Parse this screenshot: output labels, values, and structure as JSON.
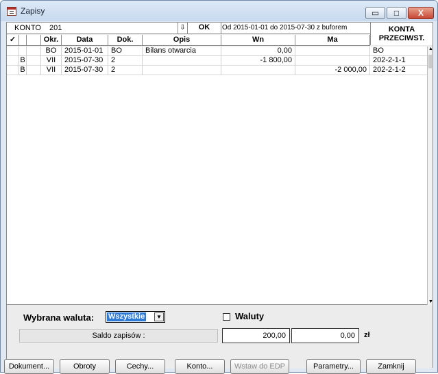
{
  "window": {
    "title": "Zapisy",
    "minimize": "▭",
    "maximize": "□",
    "close": "X"
  },
  "account": {
    "label": "KONTO",
    "number": "201",
    "ok": "OK",
    "period_text": "Od  2015-01-01   do   2015-07-30    z buforem",
    "counter_header": "KONTA PRZECIWST."
  },
  "table": {
    "headers": {
      "check": "✓",
      "okr": "Okr.",
      "date": "Data",
      "doc": "Dok.",
      "desc": "Opis",
      "wn": "Wn",
      "ma": "Ma"
    },
    "rows": [
      {
        "flag": "",
        "okr": "BO",
        "date": "2015-01-01",
        "doc": "BO",
        "desc": "Bilans otwarcia",
        "wn": "0,00",
        "ma": "",
        "account": "BO"
      },
      {
        "flag": "B",
        "okr": "VII",
        "date": "2015-07-30",
        "doc": "2",
        "desc": "",
        "wn": "-1 800,00",
        "ma": "",
        "account": "202-2-1-1"
      },
      {
        "flag": "B",
        "okr": "VII",
        "date": "2015-07-30",
        "doc": "2",
        "desc": "",
        "wn": "",
        "ma": "-2 000,00",
        "account": "202-2-1-2"
      }
    ]
  },
  "filters": {
    "currency_label": "Wybrana waluta:",
    "currency_value": "Wszystkie",
    "waluty_label": "Waluty"
  },
  "summary": {
    "saldo_label": "Saldo zapisów :",
    "wn": "200,00",
    "ma": "0,00",
    "unit": "zł"
  },
  "buttons": {
    "dokument": "Dokument...",
    "obroty": "Obroty",
    "cechy": "Cechy...",
    "konto": "Konto...",
    "edp": "Wstaw do EDP",
    "parametry": "Parametry...",
    "zamknij": "Zamknij"
  }
}
